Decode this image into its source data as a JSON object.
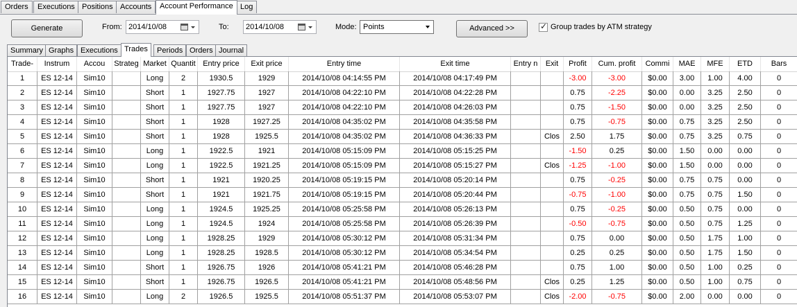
{
  "top_tabs": [
    "Orders",
    "Executions",
    "Positions",
    "Accounts",
    "Account Performance",
    "Log"
  ],
  "toolbar": {
    "generate_label": "Generate",
    "from_label": "From:",
    "from_value": "2014/10/08",
    "to_label": "To:",
    "to_value": "2014/10/08",
    "mode_label": "Mode:",
    "mode_value": "Points",
    "advanced_label": "Advanced >>",
    "group_label": "Group trades by ATM strategy",
    "group_checked": true
  },
  "inner_tabs": [
    "Summary",
    "Graphs",
    "Executions",
    "Trades",
    "Periods",
    "Orders",
    "Journal"
  ],
  "columns": [
    "Trade-",
    "Instrum",
    "Accou",
    "Strateg",
    "Market",
    "Quantit",
    "Entry price",
    "Exit price",
    "Entry time",
    "Exit time",
    "Entry n",
    "Exit",
    "Profit",
    "Cum. profit",
    "Commi",
    "MAE",
    "MFE",
    "ETD",
    "Bars"
  ],
  "rows": [
    [
      "1",
      "ES 12-14",
      "Sim10",
      "",
      "Long",
      "2",
      "1930.5",
      "1929",
      "2014/10/08 04:14:55 PM",
      "2014/10/08 04:17:49 PM",
      "",
      "",
      "-3.00",
      "-3.00",
      "$0.00",
      "3.00",
      "1.00",
      "4.00",
      "0"
    ],
    [
      "2",
      "ES 12-14",
      "Sim10",
      "",
      "Short",
      "1",
      "1927.75",
      "1927",
      "2014/10/08 04:22:10 PM",
      "2014/10/08 04:22:28 PM",
      "",
      "",
      "0.75",
      "-2.25",
      "$0.00",
      "0.00",
      "3.25",
      "2.50",
      "0"
    ],
    [
      "3",
      "ES 12-14",
      "Sim10",
      "",
      "Short",
      "1",
      "1927.75",
      "1927",
      "2014/10/08 04:22:10 PM",
      "2014/10/08 04:26:03 PM",
      "",
      "",
      "0.75",
      "-1.50",
      "$0.00",
      "0.00",
      "3.25",
      "2.50",
      "0"
    ],
    [
      "4",
      "ES 12-14",
      "Sim10",
      "",
      "Short",
      "1",
      "1928",
      "1927.25",
      "2014/10/08 04:35:02 PM",
      "2014/10/08 04:35:58 PM",
      "",
      "",
      "0.75",
      "-0.75",
      "$0.00",
      "0.75",
      "3.25",
      "2.50",
      "0"
    ],
    [
      "5",
      "ES 12-14",
      "Sim10",
      "",
      "Short",
      "1",
      "1928",
      "1925.5",
      "2014/10/08 04:35:02 PM",
      "2014/10/08 04:36:33 PM",
      "",
      "Clos",
      "2.50",
      "1.75",
      "$0.00",
      "0.75",
      "3.25",
      "0.75",
      "0"
    ],
    [
      "6",
      "ES 12-14",
      "Sim10",
      "",
      "Long",
      "1",
      "1922.5",
      "1921",
      "2014/10/08 05:15:09 PM",
      "2014/10/08 05:15:25 PM",
      "",
      "",
      "-1.50",
      "0.25",
      "$0.00",
      "1.50",
      "0.00",
      "0.00",
      "0"
    ],
    [
      "7",
      "ES 12-14",
      "Sim10",
      "",
      "Long",
      "1",
      "1922.5",
      "1921.25",
      "2014/10/08 05:15:09 PM",
      "2014/10/08 05:15:27 PM",
      "",
      "Clos",
      "-1.25",
      "-1.00",
      "$0.00",
      "1.50",
      "0.00",
      "0.00",
      "0"
    ],
    [
      "8",
      "ES 12-14",
      "Sim10",
      "",
      "Short",
      "1",
      "1921",
      "1920.25",
      "2014/10/08 05:19:15 PM",
      "2014/10/08 05:20:14 PM",
      "",
      "",
      "0.75",
      "-0.25",
      "$0.00",
      "0.75",
      "0.75",
      "0.00",
      "0"
    ],
    [
      "9",
      "ES 12-14",
      "Sim10",
      "",
      "Short",
      "1",
      "1921",
      "1921.75",
      "2014/10/08 05:19:15 PM",
      "2014/10/08 05:20:44 PM",
      "",
      "",
      "-0.75",
      "-1.00",
      "$0.00",
      "0.75",
      "0.75",
      "1.50",
      "0"
    ],
    [
      "10",
      "ES 12-14",
      "Sim10",
      "",
      "Long",
      "1",
      "1924.5",
      "1925.25",
      "2014/10/08 05:25:58 PM",
      "2014/10/08 05:26:13 PM",
      "",
      "",
      "0.75",
      "-0.25",
      "$0.00",
      "0.50",
      "0.75",
      "0.00",
      "0"
    ],
    [
      "11",
      "ES 12-14",
      "Sim10",
      "",
      "Long",
      "1",
      "1924.5",
      "1924",
      "2014/10/08 05:25:58 PM",
      "2014/10/08 05:26:39 PM",
      "",
      "",
      "-0.50",
      "-0.75",
      "$0.00",
      "0.50",
      "0.75",
      "1.25",
      "0"
    ],
    [
      "12",
      "ES 12-14",
      "Sim10",
      "",
      "Long",
      "1",
      "1928.25",
      "1929",
      "2014/10/08 05:30:12 PM",
      "2014/10/08 05:31:34 PM",
      "",
      "",
      "0.75",
      "0.00",
      "$0.00",
      "0.50",
      "1.75",
      "1.00",
      "0"
    ],
    [
      "13",
      "ES 12-14",
      "Sim10",
      "",
      "Long",
      "1",
      "1928.25",
      "1928.5",
      "2014/10/08 05:30:12 PM",
      "2014/10/08 05:34:54 PM",
      "",
      "",
      "0.25",
      "0.25",
      "$0.00",
      "0.50",
      "1.75",
      "1.50",
      "0"
    ],
    [
      "14",
      "ES 12-14",
      "Sim10",
      "",
      "Short",
      "1",
      "1926.75",
      "1926",
      "2014/10/08 05:41:21 PM",
      "2014/10/08 05:46:28 PM",
      "",
      "",
      "0.75",
      "1.00",
      "$0.00",
      "0.50",
      "1.00",
      "0.25",
      "0"
    ],
    [
      "15",
      "ES 12-14",
      "Sim10",
      "",
      "Short",
      "1",
      "1926.75",
      "1926.5",
      "2014/10/08 05:41:21 PM",
      "2014/10/08 05:48:56 PM",
      "",
      "Clos",
      "0.25",
      "1.25",
      "$0.00",
      "0.50",
      "1.00",
      "0.75",
      "0"
    ],
    [
      "16",
      "ES 12-14",
      "Sim10",
      "",
      "Long",
      "2",
      "1926.5",
      "1925.5",
      "2014/10/08 05:51:37 PM",
      "2014/10/08 05:53:07 PM",
      "",
      "Clos",
      "-2.00",
      "-0.75",
      "$0.00",
      "2.00",
      "0.00",
      "0.00",
      "0"
    ]
  ],
  "colors": {
    "negative": "#ff0000",
    "grid_line": "#a0a0a0",
    "window_bg": "#f0f0f0"
  }
}
